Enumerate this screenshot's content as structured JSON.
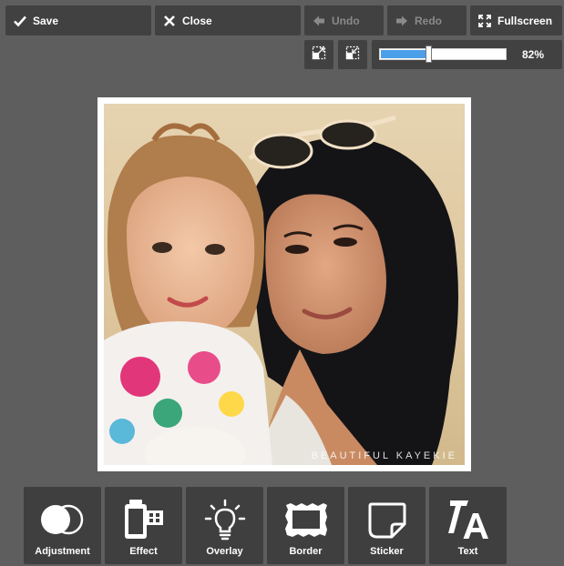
{
  "toolbar": {
    "save_label": "Save",
    "close_label": "Close",
    "undo_label": "Undo",
    "redo_label": "Redo",
    "fullscreen_label": "Fullscreen"
  },
  "view_controls": {
    "fit_icon": "expand-arrow-icon",
    "actual_icon": "shrink-arrow-icon"
  },
  "zoom": {
    "value": 0.82,
    "label": "82%"
  },
  "image": {
    "watermark": "BEAUTIFUL KAYEKIE"
  },
  "tools": [
    {
      "label": "Adjustment",
      "icon": "two-circles-icon"
    },
    {
      "label": "Effect",
      "icon": "film-canister-icon"
    },
    {
      "label": "Overlay",
      "icon": "lightbulb-icon"
    },
    {
      "label": "Border",
      "icon": "frame-border-icon"
    },
    {
      "label": "Sticker",
      "icon": "sticker-note-icon"
    },
    {
      "label": "Text",
      "icon": "text-aa-icon"
    }
  ],
  "colors": {
    "background": "#5e5e5e",
    "panel": "#414141",
    "accent": "#4a9fe8"
  }
}
